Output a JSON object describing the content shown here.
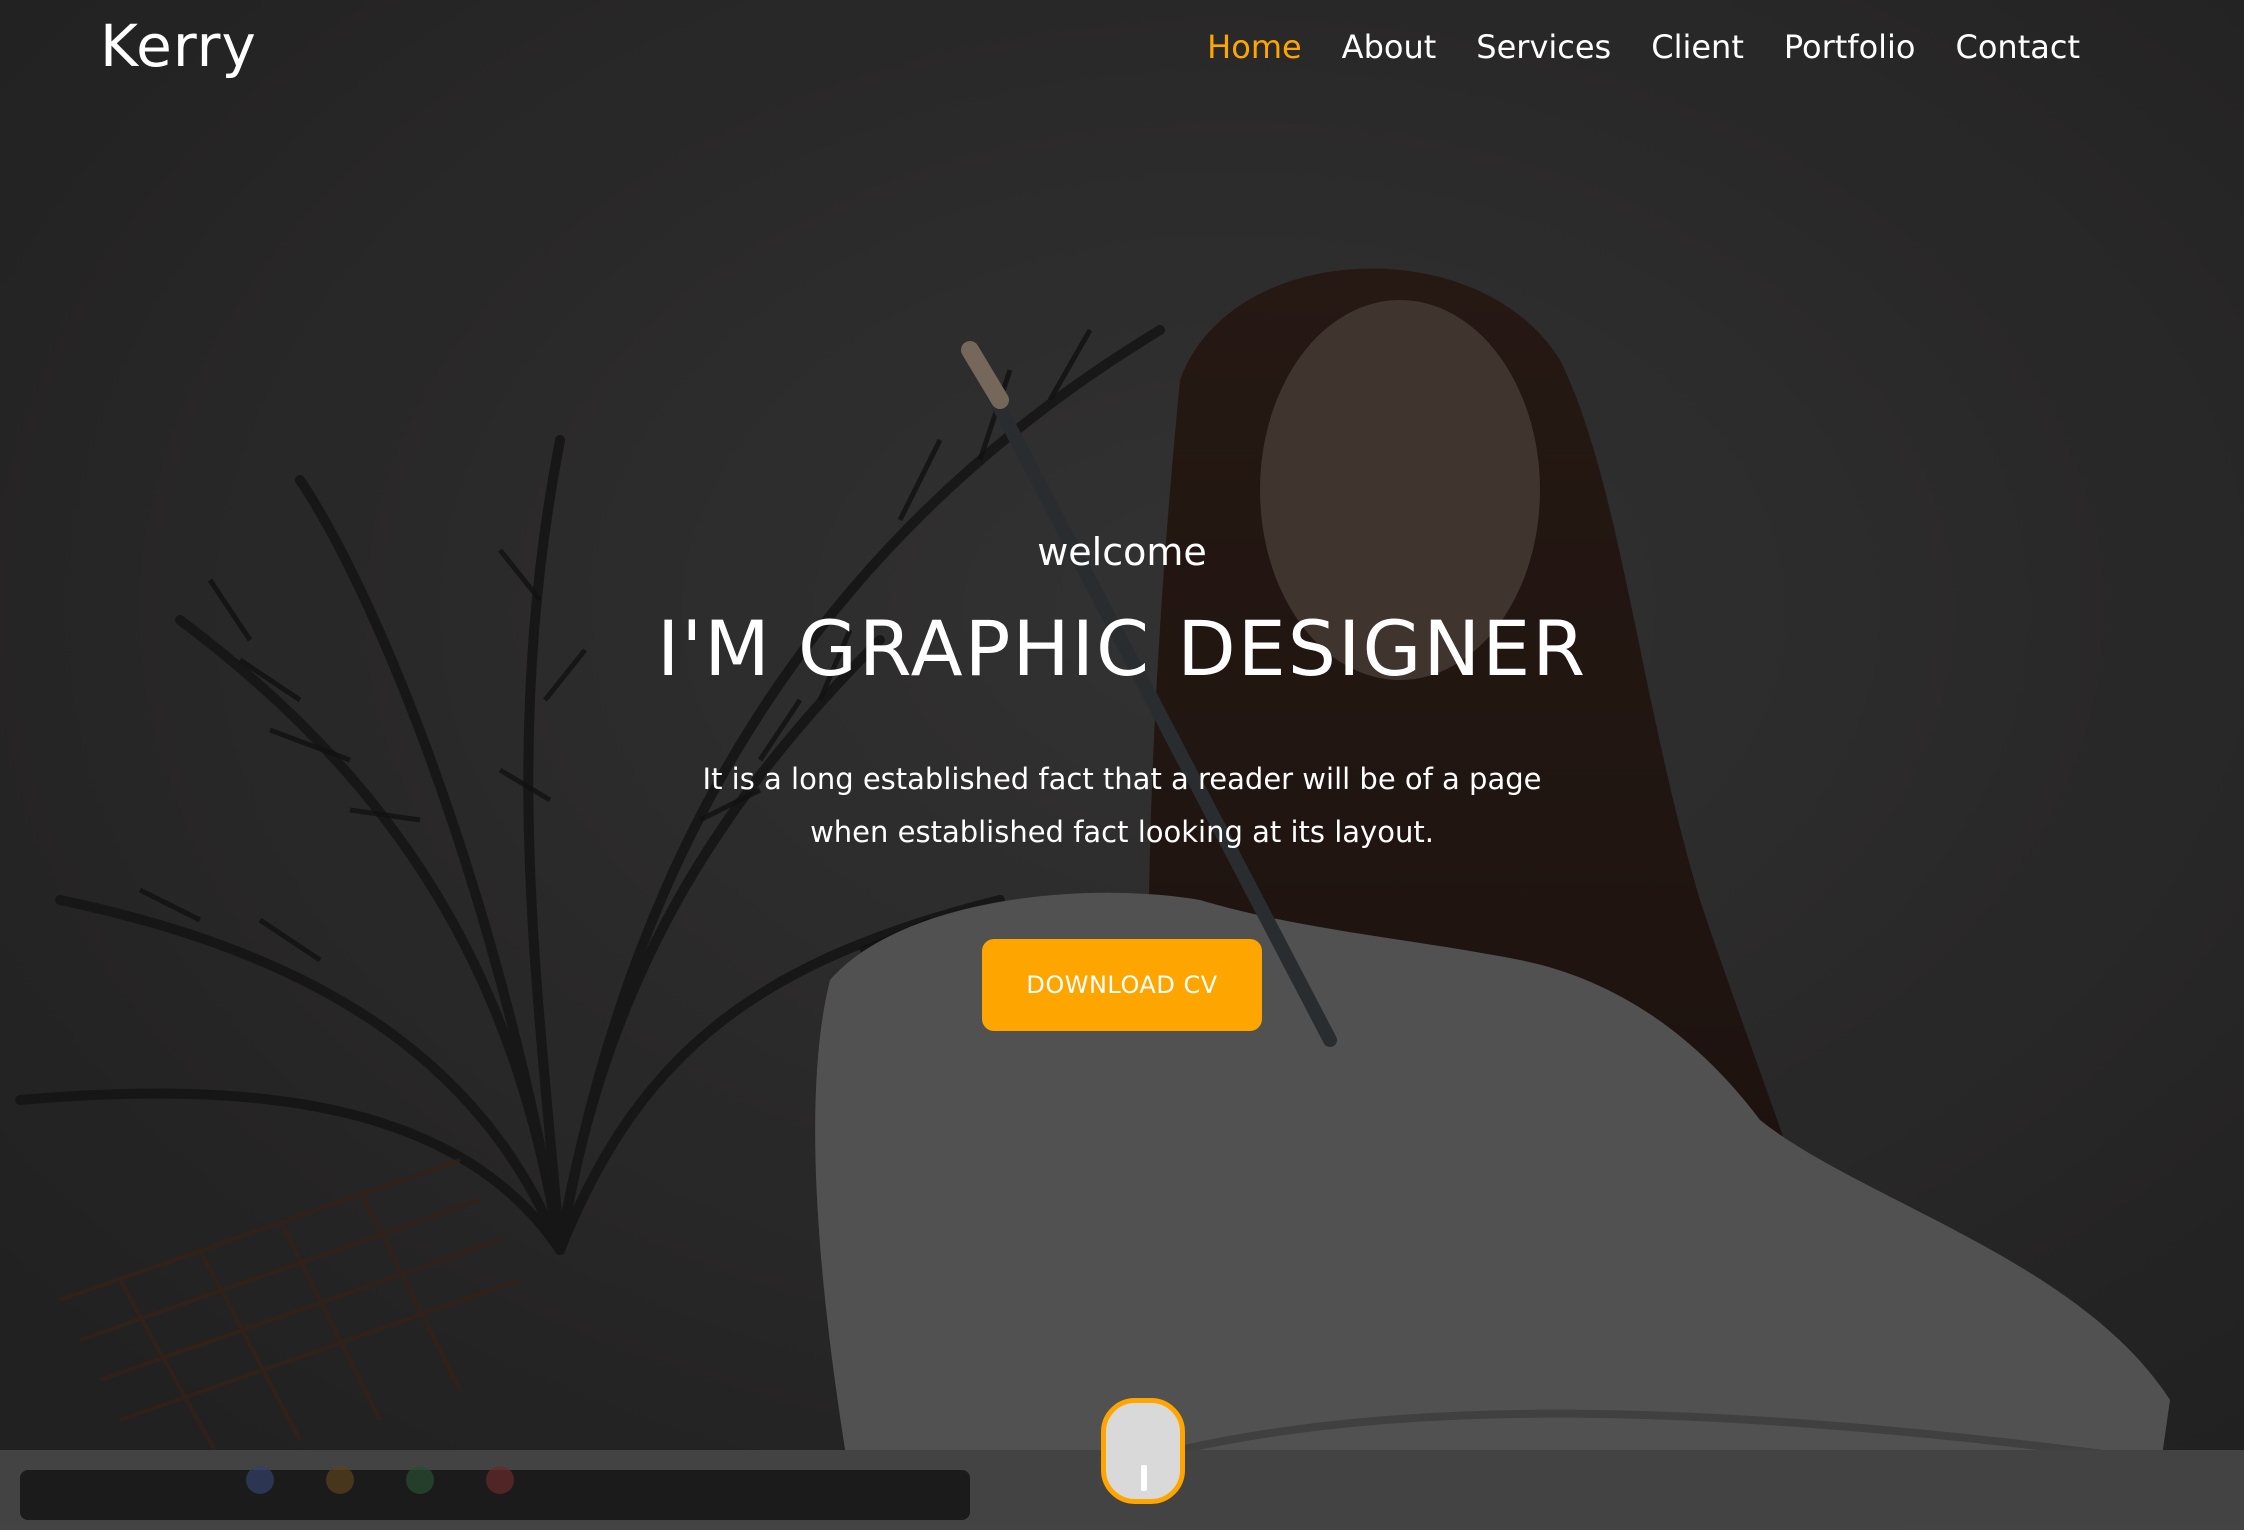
{
  "header": {
    "logo": "Kerry",
    "nav": [
      {
        "label": "Home",
        "active": true
      },
      {
        "label": "About",
        "active": false
      },
      {
        "label": "Services",
        "active": false
      },
      {
        "label": "Client",
        "active": false
      },
      {
        "label": "Portfolio",
        "active": false
      },
      {
        "label": "Contact",
        "active": false
      }
    ]
  },
  "hero": {
    "welcome": "welcome",
    "headline": "I'M GRAPHIC DESIGNER",
    "description": "It is a long established fact that a reader will be of a page when established fact looking at its layout.",
    "cta_label": "DOWNLOAD CV",
    "background_image": "woman-with-paintbrush-photo",
    "scroll_icon": "mouse-scroll-icon"
  },
  "colors": {
    "accent": "#ffa500",
    "text": "#ffffff",
    "overlay": "#2c2b2b"
  }
}
